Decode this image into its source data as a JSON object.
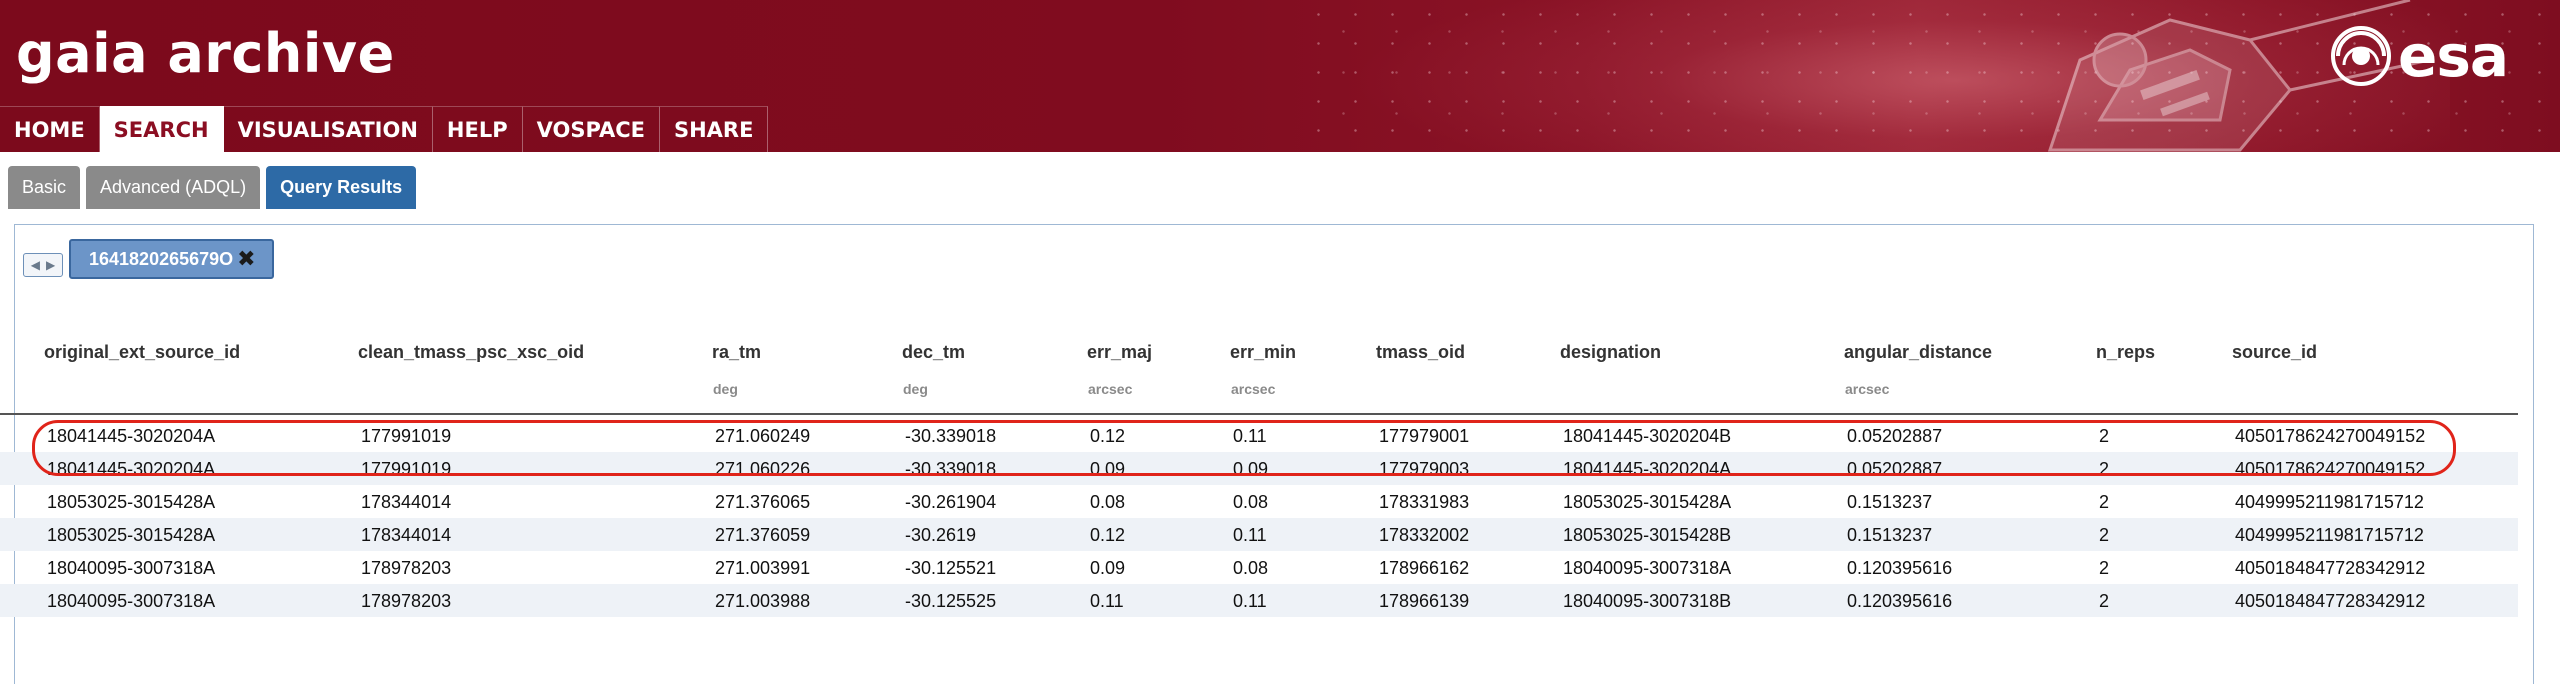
{
  "header": {
    "site_title": "gaia archive",
    "logo_text": "esa"
  },
  "nav": {
    "items": [
      "HOME",
      "SEARCH",
      "VISUALISATION",
      "HELP",
      "VOSPACE",
      "SHARE"
    ],
    "active": "SEARCH"
  },
  "subtabs": {
    "items": [
      "Basic",
      "Advanced (ADQL)",
      "Query Results"
    ],
    "active": "Query Results"
  },
  "result_tab": {
    "label": "1641820265679O"
  },
  "table": {
    "columns": [
      {
        "name": "original_ext_source_id",
        "unit": ""
      },
      {
        "name": "clean_tmass_psc_xsc_oid",
        "unit": ""
      },
      {
        "name": "ra_tm",
        "unit": "deg"
      },
      {
        "name": "dec_tm",
        "unit": "deg"
      },
      {
        "name": "err_maj",
        "unit": "arcsec"
      },
      {
        "name": "err_min",
        "unit": "arcsec"
      },
      {
        "name": "tmass_oid",
        "unit": ""
      },
      {
        "name": "designation",
        "unit": ""
      },
      {
        "name": "angular_distance",
        "unit": "arcsec"
      },
      {
        "name": "n_reps",
        "unit": ""
      },
      {
        "name": "source_id",
        "unit": ""
      }
    ],
    "rows": [
      [
        "18041445-3020204A",
        "177991019",
        "271.060249",
        "-30.339018",
        "0.12",
        "0.11",
        "177979001",
        "18041445-3020204B",
        "0.05202887",
        "2",
        "4050178624270049152"
      ],
      [
        "18041445-3020204A",
        "177991019",
        "271.060226",
        "-30.339018",
        "0.09",
        "0.09",
        "177979003",
        "18041445-3020204A",
        "0.05202887",
        "2",
        "4050178624270049152"
      ],
      [
        "18053025-3015428A",
        "178344014",
        "271.376065",
        "-30.261904",
        "0.08",
        "0.08",
        "178331983",
        "18053025-3015428A",
        "0.1513237",
        "2",
        "4049995211981715712"
      ],
      [
        "18053025-3015428A",
        "178344014",
        "271.376059",
        "-30.2619",
        "0.12",
        "0.11",
        "178332002",
        "18053025-3015428B",
        "0.1513237",
        "2",
        "4049995211981715712"
      ],
      [
        "18040095-3007318A",
        "178978203",
        "271.003991",
        "-30.125521",
        "0.09",
        "0.08",
        "178966162",
        "18040095-3007318A",
        "0.120395616",
        "2",
        "4050184847728342912"
      ],
      [
        "18040095-3007318A",
        "178978203",
        "271.003988",
        "-30.125525",
        "0.11",
        "0.11",
        "178966139",
        "18040095-3007318B",
        "0.120395616",
        "2",
        "4050184847728342912"
      ]
    ]
  },
  "colors": {
    "banner": "#800c1f",
    "active_subtab": "#2d6aa6",
    "result_tab": "#6c95c8",
    "highlight": "#e0241a"
  }
}
